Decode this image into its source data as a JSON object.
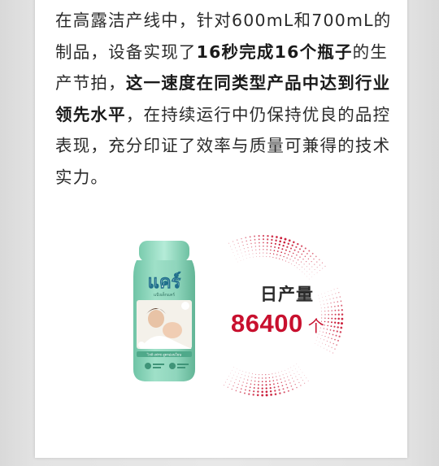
{
  "article": {
    "seg1": "在高露洁产线中，针对600mL和700mL的制品，设备实现了",
    "seg2_bold": "16秒完成16个瓶子",
    "seg3": "的生产节拍，",
    "seg4_bold": "这一速度在同类型产品中达到行业领先水平",
    "seg5": "，在持续运行中仍保持优良的品控表现，充分印证了效率与质量可兼得的技术实力。"
  },
  "stat": {
    "label": "日产量",
    "value": "86400",
    "unit": "个"
  },
  "product": {
    "brand": "แคร์",
    "subtitle": "แป้งเด็กแคร์",
    "bottom_label": "ไวท์ เฟรช สูตรอ่อนโยน",
    "icon": "baby-powder-bottle"
  },
  "colors": {
    "accent_red": "#c8102e",
    "bottle_mint": "#8fd5bc",
    "text": "#2b2b2b"
  }
}
